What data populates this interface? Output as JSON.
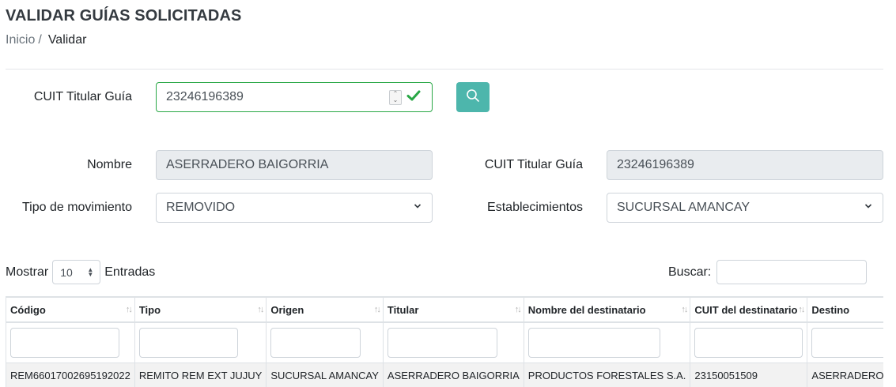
{
  "page": {
    "title": "VALIDAR GUÍAS SOLICITADAS"
  },
  "breadcrumb": {
    "home": "Inicio",
    "separator": "/",
    "current": "Validar"
  },
  "search_form": {
    "cuit_label": "CUIT Titular Guía",
    "cuit_value": "23246196389",
    "search_icon": "search-icon",
    "button_color": "#4db6ac",
    "valid_color": "#28a745"
  },
  "details": {
    "nombre_label": "Nombre",
    "nombre_value": "ASERRADERO BAIGORRIA",
    "cuit_label": "CUIT Titular Guía",
    "cuit_value": "23246196389",
    "tipo_mov_label": "Tipo de movimiento",
    "tipo_mov_value": "REMOVIDO",
    "establecimientos_label": "Establecimientos",
    "establecimientos_value": "SUCURSAL AMANCAY"
  },
  "table_controls": {
    "show_label": "Mostrar",
    "page_length": "10",
    "entries_label": "Entradas",
    "search_label": "Buscar:"
  },
  "table": {
    "columns": [
      "Código",
      "Tipo",
      "Origen",
      "Titular",
      "Nombre del destinatario",
      "CUIT del destinatario",
      "Destino"
    ],
    "rows": [
      [
        "REM66017002695192022",
        "REMITO REM EXT JUJUY",
        "SUCURSAL AMANCAY",
        "ASERRADERO BAIGORRIA",
        "PRODUCTOS FORESTALES S.A.",
        "23150051509",
        "ASERRADERO DEL SC"
      ]
    ]
  }
}
